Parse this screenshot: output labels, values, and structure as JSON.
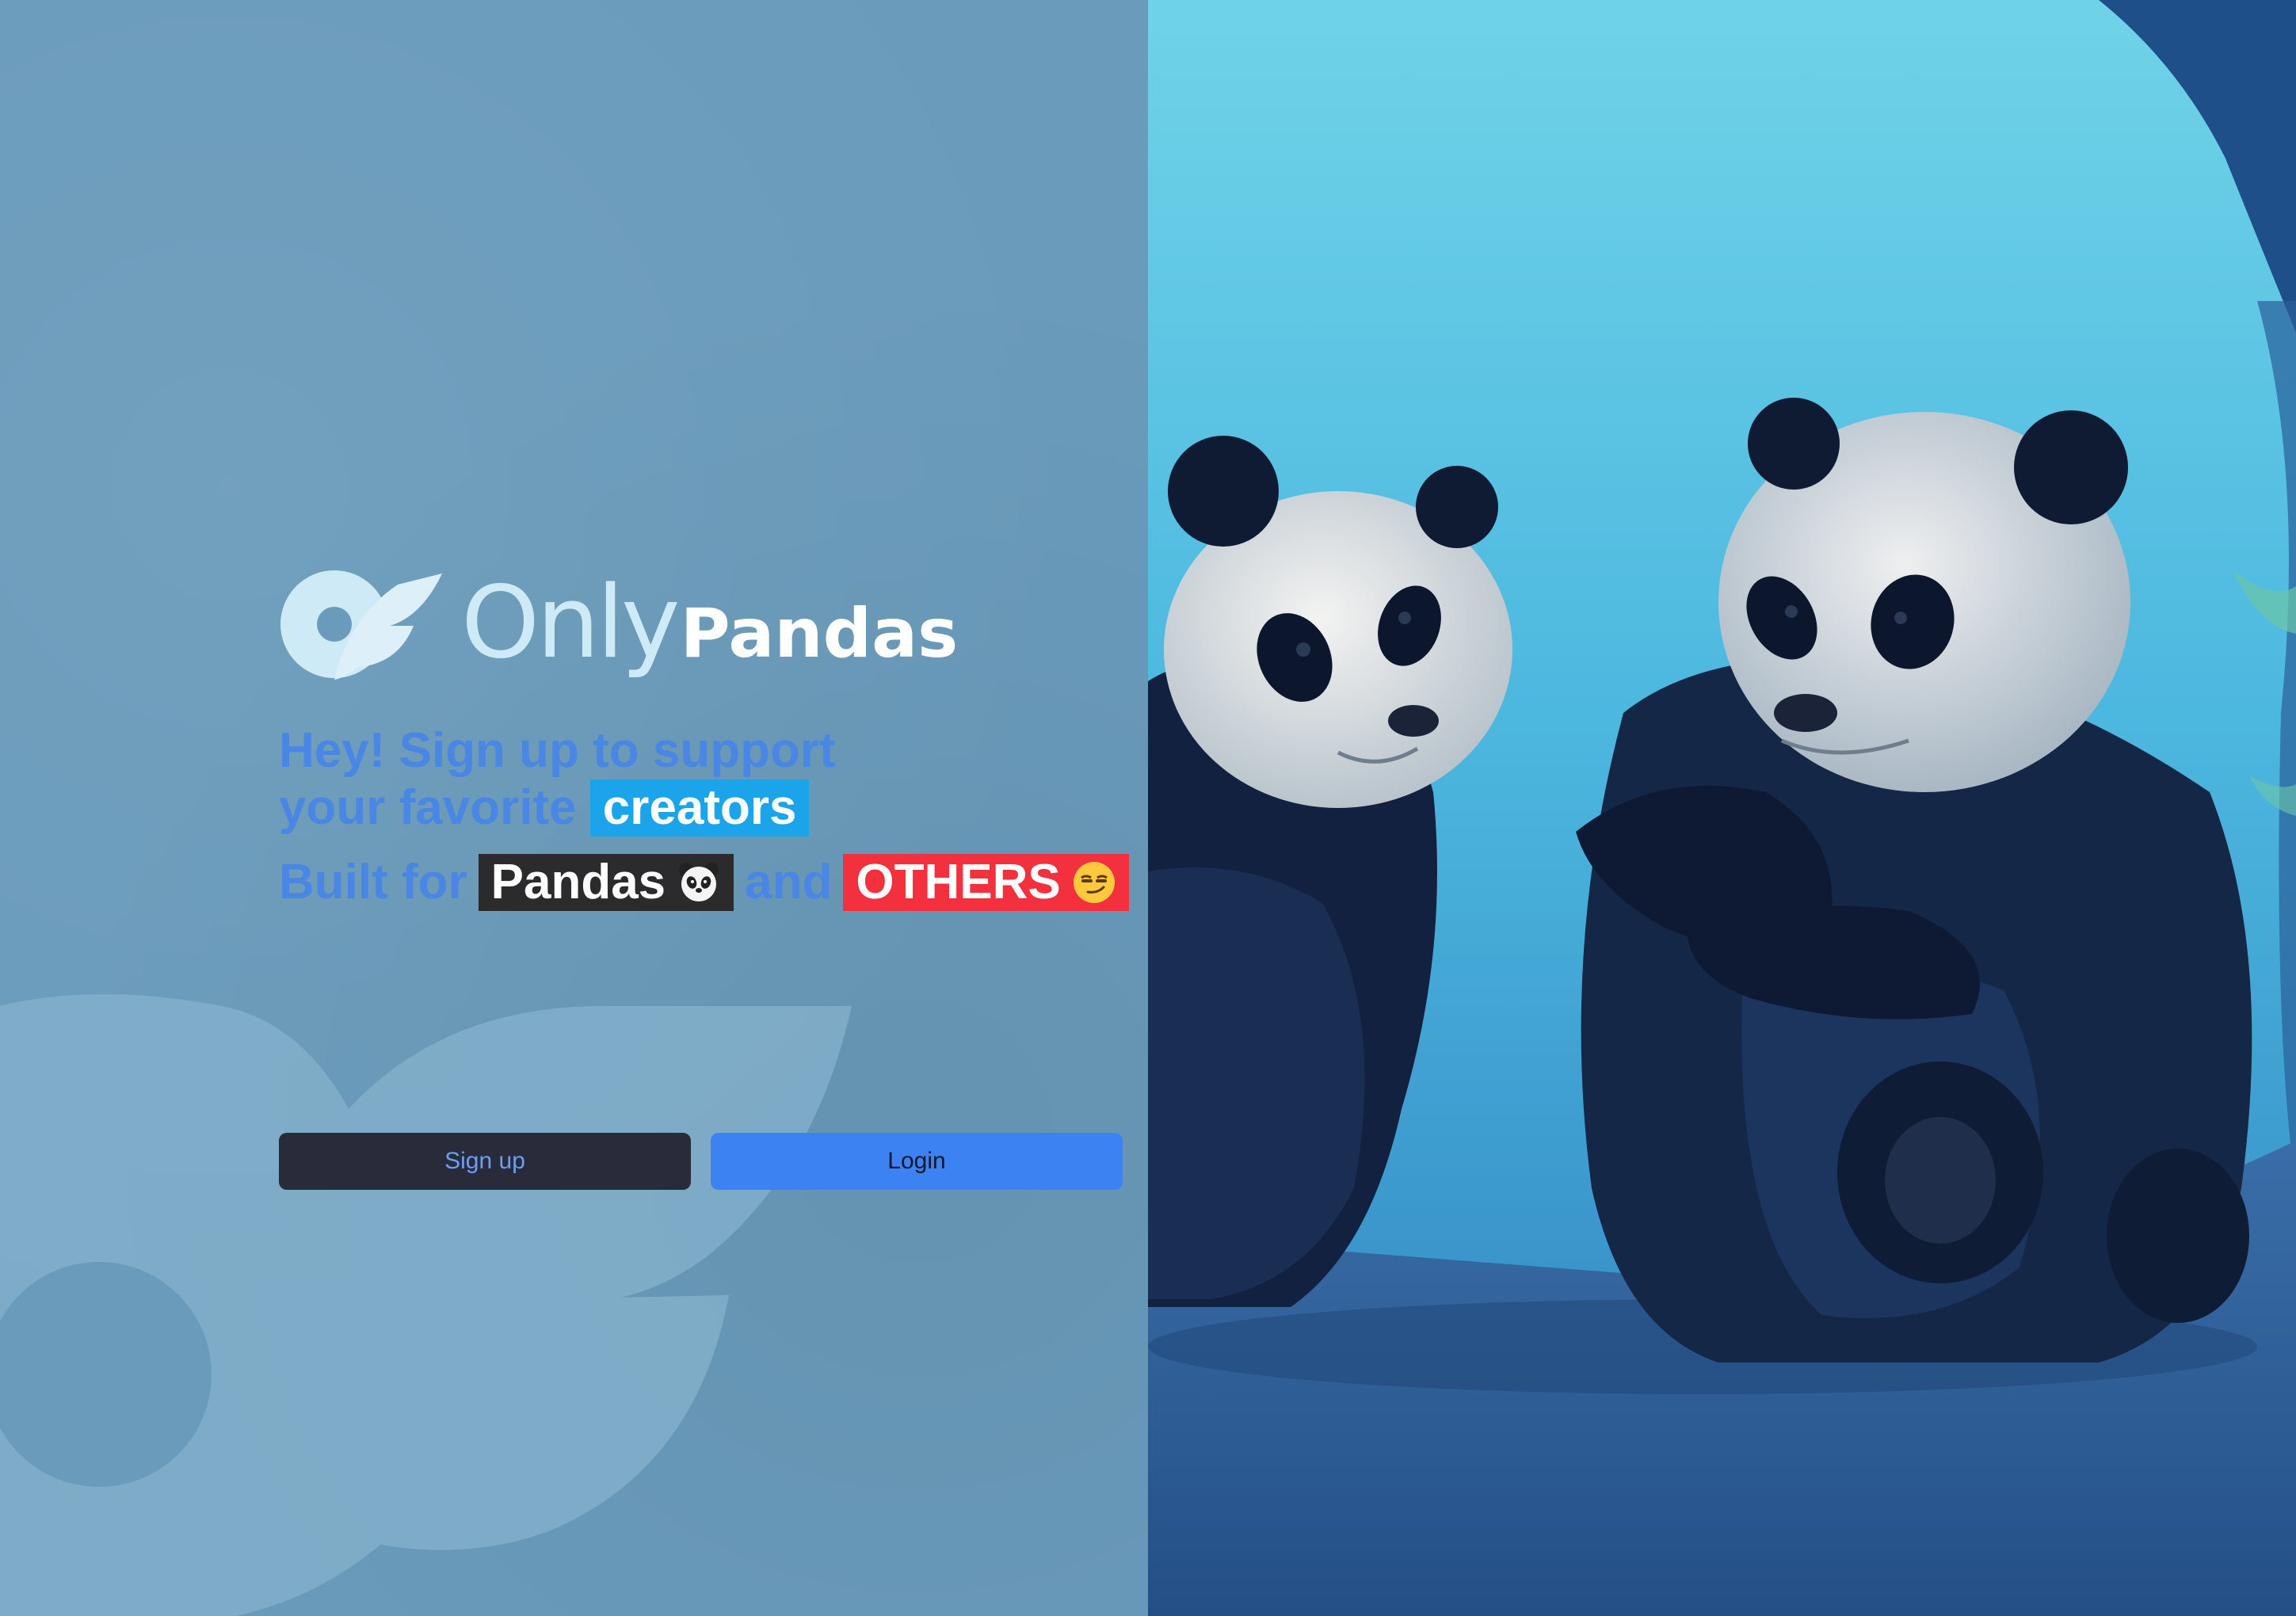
{
  "brand": {
    "name_part1": "Only",
    "name_part2": "Pandas"
  },
  "tagline": {
    "line1": "Hey! Sign up to support",
    "line2_prefix": "your favorite",
    "line2_highlight": "creators"
  },
  "built_for": {
    "prefix": "Built for",
    "highlight1": "Pandas",
    "connector": "and",
    "highlight2": "OTHERS"
  },
  "buttons": {
    "signup_label": "Sign up",
    "login_label": "Login"
  },
  "hero_image": {
    "description_icon": "two-pandas-photo"
  },
  "colors": {
    "left_bg": "#6a9bbb",
    "accent_blue": "#3d82f2",
    "highlight_cyan": "#1ca4ea",
    "highlight_red": "#f2303e",
    "dark": "#2a2b3a"
  }
}
